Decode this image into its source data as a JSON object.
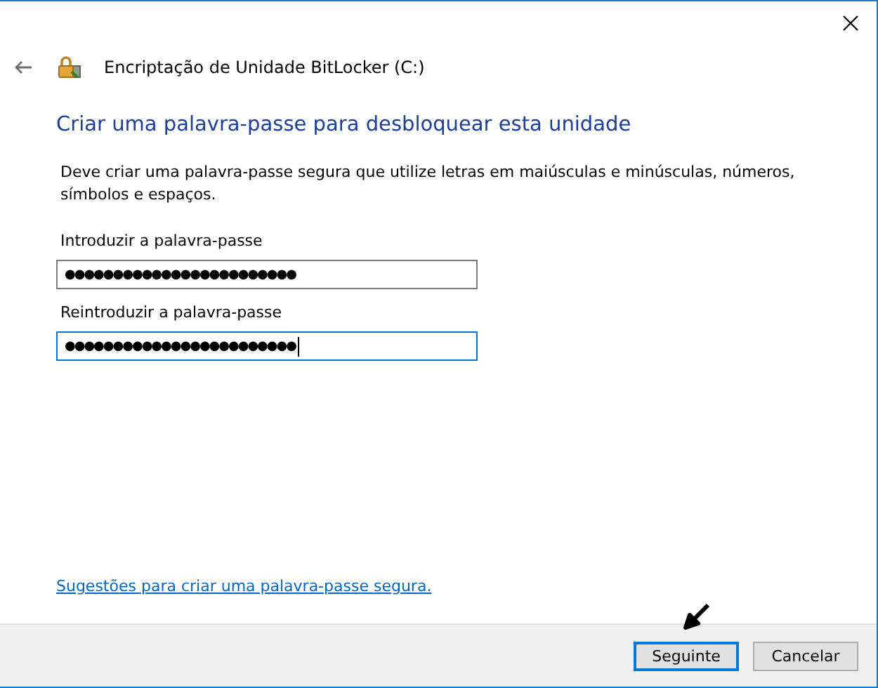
{
  "window": {
    "title": "Encriptação de Unidade BitLocker (C:)"
  },
  "heading": "Criar uma palavra-passe para desbloquear esta unidade",
  "description": "Deve criar uma palavra-passe segura que utilize letras em maiúsculas e minúsculas, números, símbolos e espaços.",
  "fields": [
    {
      "label": "Introduzir a palavra-passe",
      "value": "●●●●●●●●●●●●●●●●●●●●●●●●",
      "focused": false
    },
    {
      "label": "Reintroduzir a palavra-passe",
      "value": "●●●●●●●●●●●●●●●●●●●●●●●●",
      "focused": true
    }
  ],
  "link": "Sugestões para criar uma palavra-passe segura.",
  "buttons": [
    {
      "label": "Seguinte",
      "default": true
    },
    {
      "label": "Cancelar",
      "default": false
    }
  ]
}
